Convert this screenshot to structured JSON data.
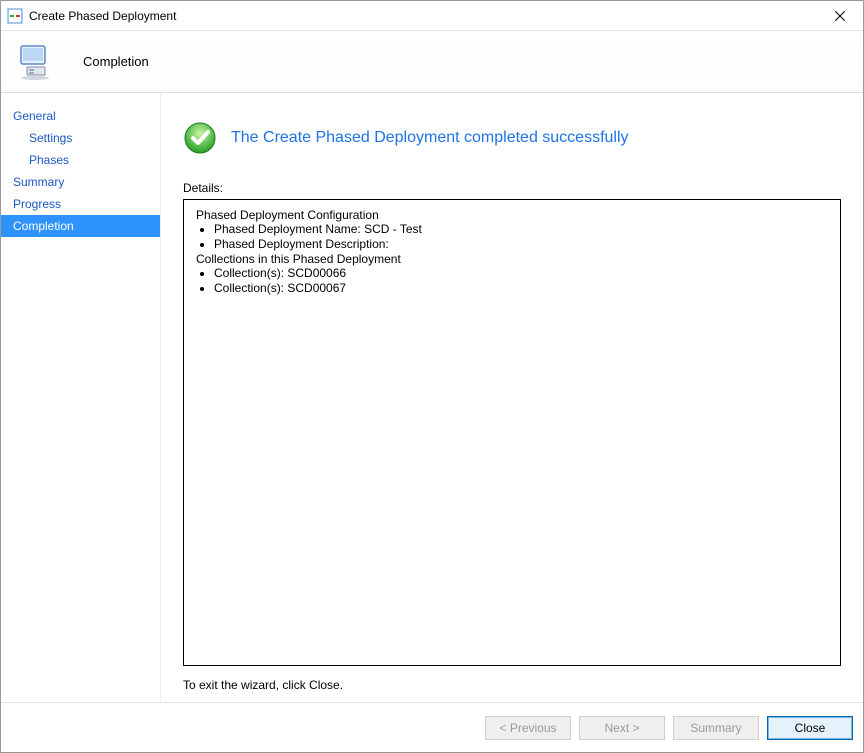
{
  "window": {
    "title": "Create Phased Deployment"
  },
  "header": {
    "title": "Completion"
  },
  "sidebar": {
    "items": [
      {
        "label": "General",
        "indent": false,
        "selected": false
      },
      {
        "label": "Settings",
        "indent": true,
        "selected": false
      },
      {
        "label": "Phases",
        "indent": true,
        "selected": false
      },
      {
        "label": "Summary",
        "indent": false,
        "selected": false
      },
      {
        "label": "Progress",
        "indent": false,
        "selected": false
      },
      {
        "label": "Completion",
        "indent": false,
        "selected": true
      }
    ]
  },
  "main": {
    "status_text": "The Create Phased Deployment completed successfully",
    "details_label": "Details:",
    "details": {
      "config_header": "Phased Deployment Configuration",
      "name_line": "Phased Deployment Name: SCD - Test",
      "desc_line": "Phased Deployment Description:",
      "collections_header": "Collections in this Phased Deployment",
      "collection_1": "Collection(s): SCD00066",
      "collection_2": "Collection(s): SCD00067"
    },
    "hint": "To exit the wizard, click Close."
  },
  "footer": {
    "previous": "< Previous",
    "next": "Next >",
    "summary": "Summary",
    "close": "Close"
  }
}
